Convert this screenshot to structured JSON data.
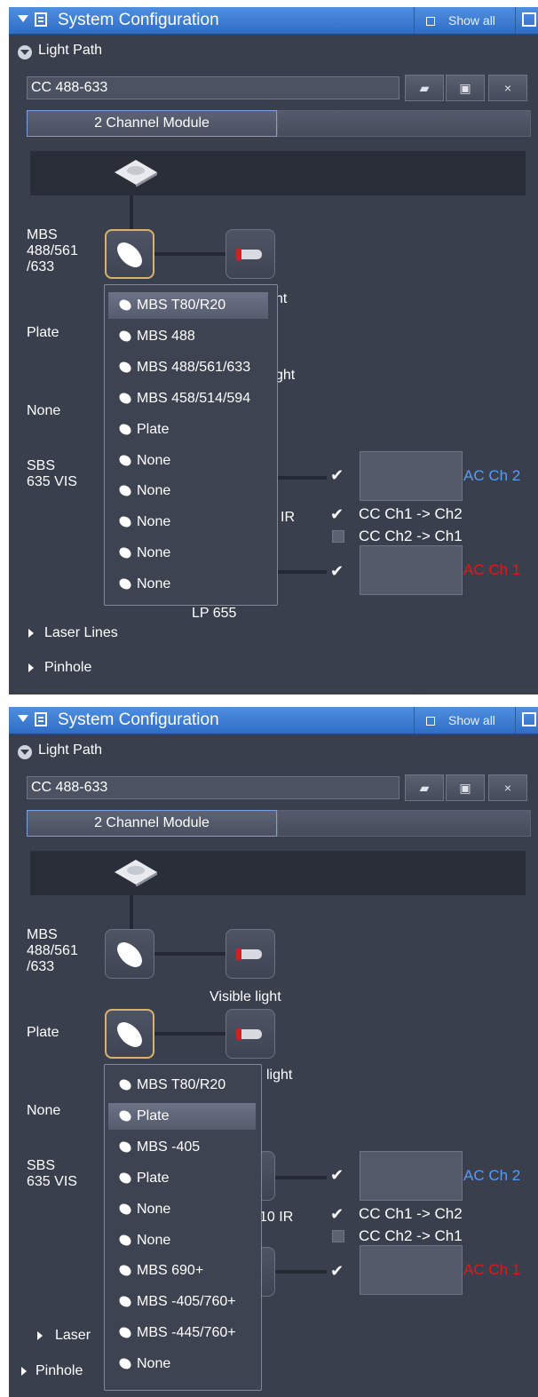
{
  "colors": {
    "accent": "#4a86d8",
    "ch2": "#5a9bef",
    "ch1": "#e01818",
    "selection_border": "#d9b36b"
  },
  "panel1": {
    "title": "System Configuration",
    "show_all": "Show all",
    "section_light_path": "Light Path",
    "config_name": "CC 488-633",
    "buttons": {
      "open": "▰",
      "save": "▣",
      "close": "×"
    },
    "tab_active": "2 Channel Module",
    "labels": {
      "mbs": "MBS\n488/561\n/633",
      "plate": "Plate",
      "none": "None",
      "sbs": "SBS\n635 VIS",
      "lp655": "LP 655"
    },
    "partial": {
      "ht": "ht",
      "ght": "ght",
      "ir": "IR"
    },
    "dropdown": [
      "MBS T80/R20",
      "MBS 488",
      "MBS 488/561/633",
      "MBS 458/514/594",
      "Plate",
      "None",
      "None",
      "None",
      "None",
      "None"
    ],
    "channels": {
      "ac2": "AC Ch 2",
      "cc12": "CC Ch1 -> Ch2",
      "cc21": "CC Ch2 -> Ch1",
      "ac1": "AC Ch 1"
    },
    "section_laser": "Laser Lines",
    "section_pinhole": "Pinhole"
  },
  "panel2": {
    "title": "System Configuration",
    "show_all": "Show all",
    "section_light_path": "Light Path",
    "config_name": "CC 488-633",
    "buttons": {
      "open": "▰",
      "save": "▣",
      "close": "×"
    },
    "tab_active": "2 Channel Module",
    "labels": {
      "mbs": "MBS\n488/561\n/633",
      "plate": "Plate",
      "none": "None",
      "sbs": "SBS\n635 VIS",
      "visible_light": "Visible light"
    },
    "partial": {
      "light": "light",
      "ir": "10 IR",
      "laser": "Laser"
    },
    "dropdown": [
      "MBS T80/R20",
      "Plate",
      "MBS -405",
      "Plate",
      "None",
      "None",
      "MBS 690+",
      "MBS -405/760+",
      "MBS -445/760+",
      "None"
    ],
    "channels": {
      "ac2": "AC Ch 2",
      "cc12": "CC Ch1 -> Ch2",
      "cc21": "CC Ch2 -> Ch1",
      "ac1": "AC Ch 1"
    },
    "section_pinhole": "Pinhole"
  }
}
